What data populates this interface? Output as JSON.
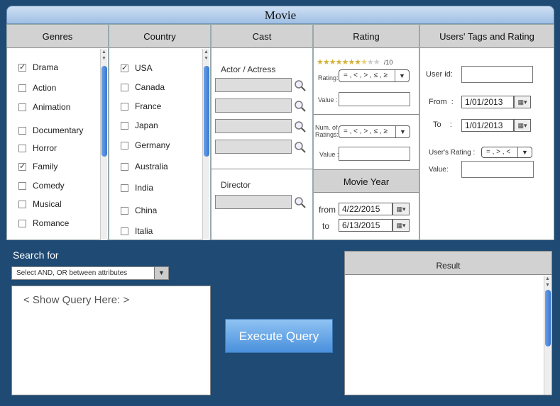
{
  "window": {
    "title": "Movie"
  },
  "genres": {
    "header": "Genres",
    "items": [
      {
        "label": "Drama",
        "checked": true
      },
      {
        "label": "Action",
        "checked": false
      },
      {
        "label": "Animation",
        "checked": false
      },
      {
        "label": "Documentary",
        "checked": false
      },
      {
        "label": "Horror",
        "checked": false
      },
      {
        "label": "Family",
        "checked": true
      },
      {
        "label": "Comedy",
        "checked": false
      },
      {
        "label": "Musical",
        "checked": false
      },
      {
        "label": "Romance",
        "checked": false
      }
    ]
  },
  "country": {
    "header": "Country",
    "items": [
      {
        "label": "USA",
        "checked": true
      },
      {
        "label": "Canada",
        "checked": false
      },
      {
        "label": "France",
        "checked": false
      },
      {
        "label": "Japan",
        "checked": false
      },
      {
        "label": "Germany",
        "checked": false
      },
      {
        "label": "Australia",
        "checked": false
      },
      {
        "label": "India",
        "checked": false
      },
      {
        "label": "China",
        "checked": false
      },
      {
        "label": "Italia",
        "checked": false
      }
    ]
  },
  "cast": {
    "header": "Cast",
    "actor_label": "Actor / Actress",
    "director_label": "Director"
  },
  "rating": {
    "header": "Rating",
    "stars_filled": 7.5,
    "stars_total": 10,
    "scale_label": "/10",
    "rating_label": "Rating:",
    "rating_op": "= , < , > , ≤ , ≥",
    "value_label": "Value :",
    "num_label_1": "Num. of",
    "num_label_2": "Ratings:",
    "num_op": "= , < , > , ≤ , ≥",
    "num_value_label": "Value :"
  },
  "movie_year": {
    "header": "Movie Year",
    "from_label": "from",
    "from_value": "4/22/2015",
    "to_label": "to",
    "to_value": "6/13/2015"
  },
  "users": {
    "header": "Users' Tags and Rating",
    "user_id_label": "User id:",
    "from_label": "From  :",
    "from_value": "1/01/2013",
    "to_label": "To    :",
    "to_value": "1/01/2013",
    "user_rating_label": "User's Rating  :",
    "user_rating_op": "= , > , <",
    "value_label": "Value:"
  },
  "search": {
    "label": "Search for",
    "select_value": "Select AND, OR between attributes",
    "query_placeholder": "< Show Query Here: >"
  },
  "execute": {
    "label": "Execute Query"
  },
  "result": {
    "header": "Result"
  },
  "icons": {
    "dropdown": "chevron-down-icon",
    "search": "magnifier-icon",
    "calendar": "calendar-icon",
    "check": "check-icon"
  }
}
